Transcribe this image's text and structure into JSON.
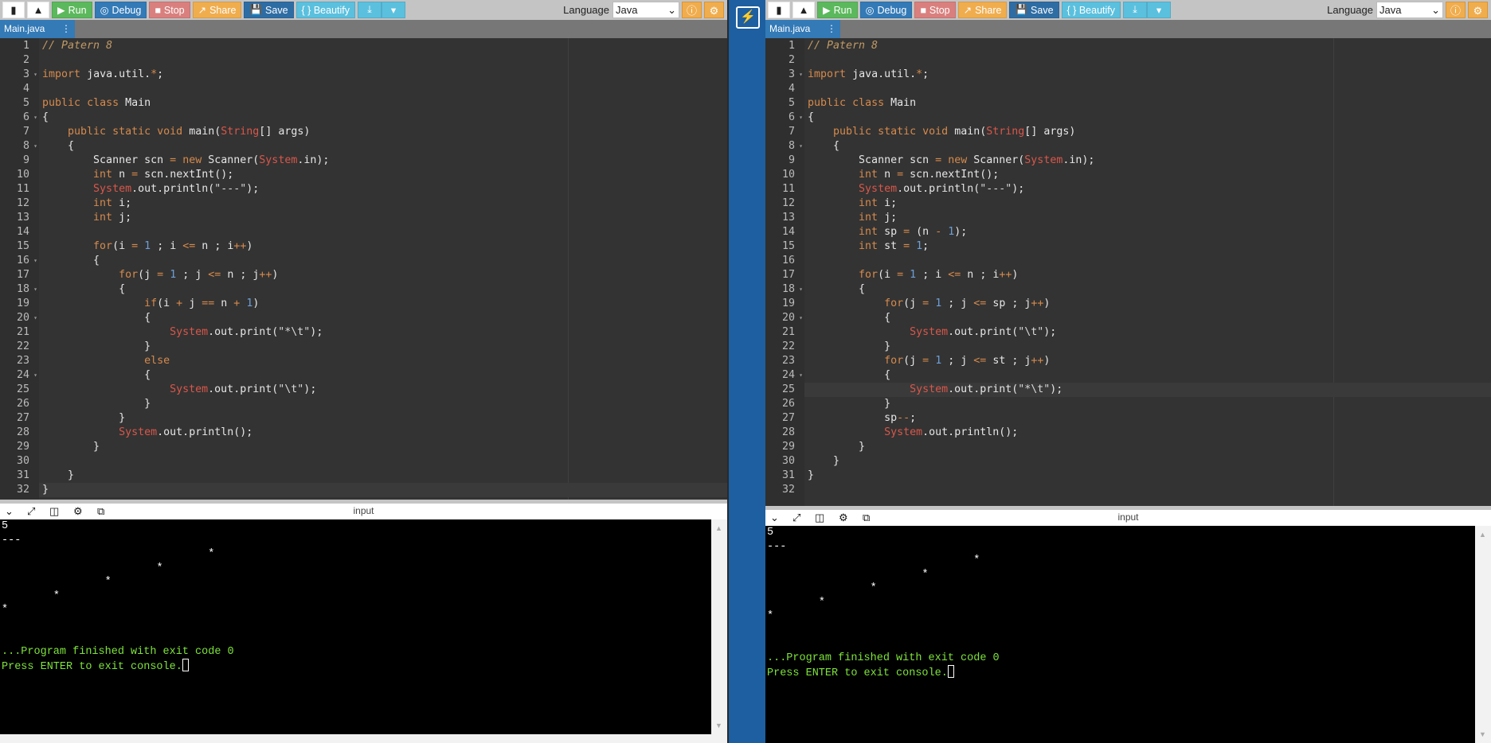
{
  "toolbar": {
    "new_icon": "file-icon",
    "upload_icon": "upload-icon",
    "run": "Run",
    "debug": "Debug",
    "stop": "Stop",
    "share": "Share",
    "save": "Save",
    "beautify": "{ } Beautify",
    "download_icon": "download-icon",
    "language_label": "Language",
    "language_value": "Java",
    "info_icon": "info-icon",
    "settings_icon": "gear-icon"
  },
  "strip": {
    "icon": "lightning-icon"
  },
  "colors": {
    "run": "#5cb85c",
    "debug": "#337ab7",
    "stop": "#d9807e",
    "share": "#f0ad4e",
    "save": "#2e6da4",
    "beautify": "#5bc0de",
    "editor_bg": "#333333",
    "console_text": "#7ee33a"
  },
  "left": {
    "tab": "Main.java",
    "active_line": 32,
    "folds": [
      3,
      6,
      8,
      16,
      18,
      20,
      24
    ],
    "code": [
      "// Patern 8",
      "",
      "import java.util.*;",
      "",
      "public class Main",
      "{",
      "    public static void main(String[] args)",
      "    {",
      "        Scanner scn = new Scanner(System.in);",
      "        int n = scn.nextInt();",
      "        System.out.println(\"---\");",
      "        int i;",
      "        int j;",
      "",
      "        for(i = 1 ; i <= n ; i++)",
      "        {",
      "            for(j = 1 ; j <= n ; j++)",
      "            {",
      "                if(i + j == n + 1)",
      "                {",
      "                    System.out.print(\"*\\t\");",
      "                }",
      "                else",
      "                {",
      "                    System.out.print(\"\\t\");",
      "                }",
      "            }",
      "            System.out.println();",
      "        }",
      "",
      "    }",
      "}"
    ],
    "console_title": "input",
    "console": [
      "5",
      "---",
      "\t\t\t\t*",
      "\t\t\t*",
      "\t\t*",
      "\t*",
      "*",
      "",
      ""
    ],
    "finished": "...Program finished with exit code 0",
    "press_enter": "Press ENTER to exit console."
  },
  "right": {
    "tab": "Main.java",
    "active_line": 25,
    "folds": [
      3,
      6,
      8,
      18,
      20,
      24
    ],
    "code": [
      "// Patern 8",
      "",
      "import java.util.*;",
      "",
      "public class Main",
      "{",
      "    public static void main(String[] args)",
      "    {",
      "        Scanner scn = new Scanner(System.in);",
      "        int n = scn.nextInt();",
      "        System.out.println(\"---\");",
      "        int i;",
      "        int j;",
      "        int sp = (n - 1);",
      "        int st = 1;",
      "",
      "        for(i = 1 ; i <= n ; i++)",
      "        {",
      "            for(j = 1 ; j <= sp ; j++)",
      "            {",
      "                System.out.print(\"\\t\");",
      "            }",
      "            for(j = 1 ; j <= st ; j++)",
      "            {",
      "                System.out.print(\"*\\t\");",
      "            }",
      "            sp--;",
      "            System.out.println();",
      "        }",
      "    }",
      "}",
      ""
    ],
    "console_title": "input",
    "console": [
      "5",
      "---",
      "\t\t\t\t*",
      "\t\t\t*",
      "\t\t*",
      "\t*",
      "*",
      "",
      ""
    ],
    "finished": "...Program finished with exit code 0",
    "press_enter": "Press ENTER to exit console."
  }
}
